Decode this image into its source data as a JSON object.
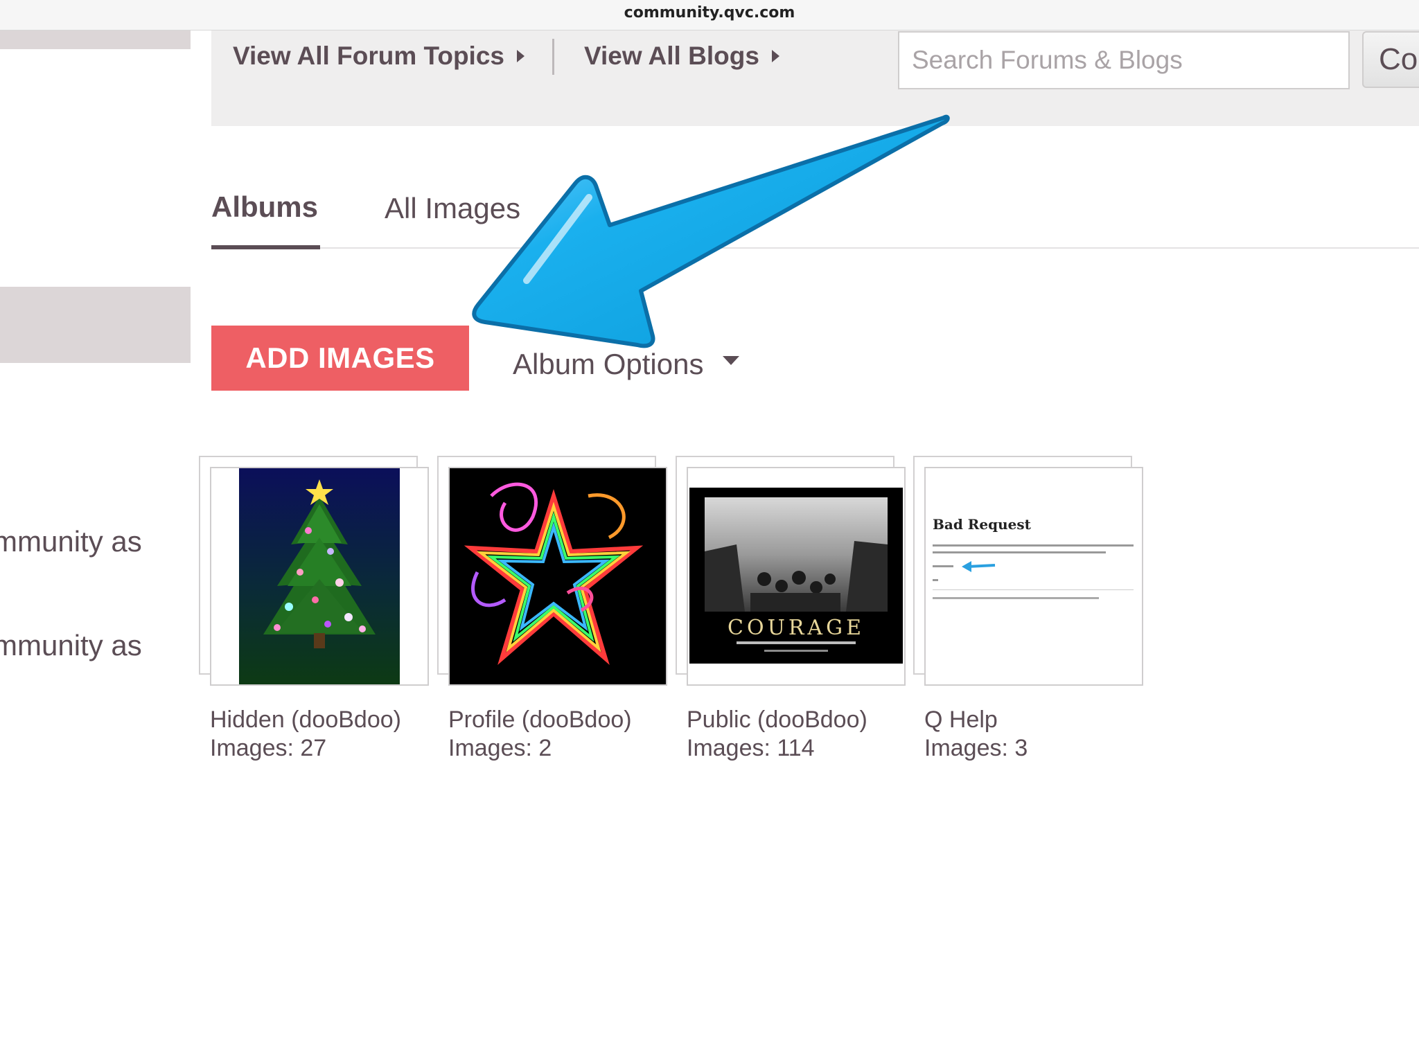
{
  "browser": {
    "url": "community.qvc.com"
  },
  "sidebar": {
    "line1": "mmunity as",
    "line2": "mmunity as"
  },
  "nav": {
    "forum_topics": "View All Forum Topics",
    "blogs": "View All Blogs",
    "search_placeholder": "Search Forums & Blogs",
    "cut_button": "Co"
  },
  "tabs": [
    {
      "label": "Albums",
      "active": true
    },
    {
      "label": "All Images",
      "active": false
    }
  ],
  "actions": {
    "add_images": "ADD IMAGES",
    "album_options": "Album Options"
  },
  "albums": [
    {
      "name": "Hidden (dooBdoo)",
      "count": "Images: 27",
      "thumb": "christmas-tree"
    },
    {
      "name": "Profile (dooBdoo)",
      "count": "Images: 2",
      "thumb": "neon-star"
    },
    {
      "name": "Public (dooBdoo)",
      "count": "Images: 114",
      "thumb": "courage-poster"
    },
    {
      "name": "Q Help",
      "count": "Images: 3",
      "thumb": "bad-request-screenshot"
    }
  ],
  "thumb_text": {
    "courage": "COURAGE",
    "bad_request": "Bad Request"
  },
  "annotation": {
    "type": "blue-arrow",
    "color": "#1aa3e0"
  }
}
